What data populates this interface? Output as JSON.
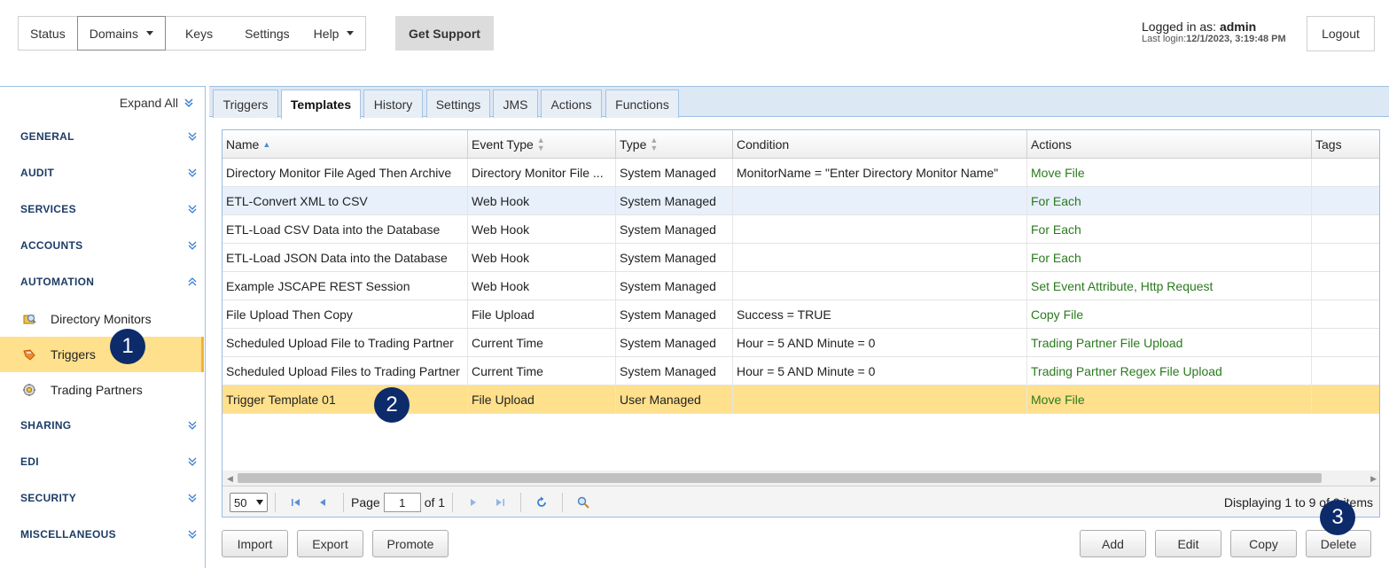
{
  "topnav": {
    "items": [
      {
        "label": "Status"
      },
      {
        "label": "Domains"
      },
      {
        "label": "Keys"
      },
      {
        "label": "Settings"
      },
      {
        "label": "Help"
      }
    ],
    "support_label": "Get Support",
    "login_prefix": "Logged in as: ",
    "login_user": "admin",
    "last_login_prefix": "Last login:",
    "last_login_value": "12/1/2023, 3:19:48 PM",
    "logout_label": "Logout"
  },
  "sidebar": {
    "expand_all": "Expand All",
    "sections": {
      "general": "GENERAL",
      "audit": "AUDIT",
      "services": "SERVICES",
      "accounts": "ACCOUNTS",
      "automation": "AUTOMATION",
      "sharing": "SHARING",
      "edi": "EDI",
      "security": "SECURITY",
      "miscellaneous": "MISCELLANEOUS"
    },
    "automation_items": [
      {
        "label": "Directory Monitors",
        "icon": "directory-monitor-icon"
      },
      {
        "label": "Triggers",
        "icon": "trigger-icon"
      },
      {
        "label": "Trading Partners",
        "icon": "trading-partner-icon"
      }
    ]
  },
  "callouts": [
    "1",
    "2",
    "3"
  ],
  "tabs": [
    "Triggers",
    "Templates",
    "History",
    "Settings",
    "JMS",
    "Actions",
    "Functions"
  ],
  "grid": {
    "columns": [
      "Name",
      "Event Type",
      "Type",
      "Condition",
      "Actions",
      "Tags"
    ],
    "rows": [
      {
        "name": "Directory Monitor File Aged Then Archive",
        "event": "Directory Monitor File ...",
        "type": "System Managed",
        "condition": "MonitorName = \"Enter Directory Monitor Name\"",
        "actions": "Move File"
      },
      {
        "name": "ETL-Convert XML to CSV",
        "event": "Web Hook",
        "type": "System Managed",
        "condition": "",
        "actions": "For Each"
      },
      {
        "name": "ETL-Load CSV Data into the Database",
        "event": "Web Hook",
        "type": "System Managed",
        "condition": "",
        "actions": "For Each"
      },
      {
        "name": "ETL-Load JSON Data into the Database",
        "event": "Web Hook",
        "type": "System Managed",
        "condition": "",
        "actions": "For Each"
      },
      {
        "name": "Example JSCAPE REST Session",
        "event": "Web Hook",
        "type": "System Managed",
        "condition": "",
        "actions": "Set Event Attribute, Http Request"
      },
      {
        "name": "File Upload Then Copy",
        "event": "File Upload",
        "type": "System Managed",
        "condition": "Success = TRUE",
        "actions": "Copy File"
      },
      {
        "name": "Scheduled Upload File to Trading Partner",
        "event": "Current Time",
        "type": "System Managed",
        "condition": "Hour = 5 AND Minute = 0",
        "actions": "Trading Partner File Upload"
      },
      {
        "name": "Scheduled Upload Files to Trading Partner",
        "event": "Current Time",
        "type": "System Managed",
        "condition": "Hour = 5 AND Minute = 0",
        "actions": "Trading Partner Regex File Upload"
      },
      {
        "name": "Trigger Template 01",
        "event": "File Upload",
        "type": "User Managed",
        "condition": "",
        "actions": "Move File"
      }
    ],
    "page_size": "50",
    "page_label": "Page",
    "page_value": "1",
    "page_of": "of 1",
    "displaying": "Displaying 1 to 9 of 9 items"
  },
  "buttons": {
    "import": "Import",
    "export": "Export",
    "promote": "Promote",
    "add": "Add",
    "edit": "Edit",
    "copy": "Copy",
    "delete": "Delete"
  }
}
